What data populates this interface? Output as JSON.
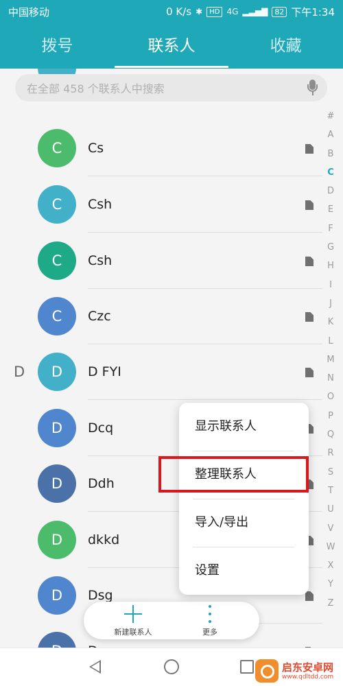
{
  "status_bar": {
    "carrier": "中国移动",
    "net_speed": "0 K/s",
    "hd_label": "HD",
    "network_label": "4G",
    "battery": "82",
    "time": "下午1:34"
  },
  "tabs": [
    {
      "label": "拨号",
      "active": false
    },
    {
      "label": "联系人",
      "active": true
    },
    {
      "label": "收藏",
      "active": false
    }
  ],
  "search": {
    "placeholder": "在全部 458 个联系人中搜索"
  },
  "contacts": [
    {
      "name": "",
      "initial": "",
      "color": "#43b0c9",
      "section": "",
      "sim_icon": false
    },
    {
      "name": "Cs",
      "initial": "C",
      "color": "#4cbc6c",
      "section": "",
      "sim_icon": true
    },
    {
      "name": "Csh",
      "initial": "C",
      "color": "#43b0c9",
      "section": "",
      "sim_icon": true
    },
    {
      "name": "Csh",
      "initial": "C",
      "color": "#1ea987",
      "section": "",
      "sim_icon": true
    },
    {
      "name": "Czc",
      "initial": "C",
      "color": "#4f86cd",
      "section": "",
      "sim_icon": true
    },
    {
      "name": "D FYI",
      "initial": "D",
      "color": "#43b0c9",
      "section": "D",
      "sim_icon": true
    },
    {
      "name": "Dcq",
      "initial": "D",
      "color": "#4f86cd",
      "section": "",
      "sim_icon": true
    },
    {
      "name": "Ddh",
      "initial": "D",
      "color": "#4a72a8",
      "section": "",
      "sim_icon": true
    },
    {
      "name": "dkkd",
      "initial": "D",
      "color": "#4cbc6c",
      "section": "",
      "sim_icon": true
    },
    {
      "name": "Dsg",
      "initial": "D",
      "color": "#4f86cd",
      "section": "",
      "sim_icon": true
    },
    {
      "name": "D",
      "initial": "D",
      "color": "#4a72a8",
      "section": "",
      "sim_icon": true
    }
  ],
  "alpha_index": [
    "#",
    "A",
    "B",
    "C",
    "D",
    "E",
    "F",
    "G",
    "H",
    "I",
    "J",
    "K",
    "L",
    "M",
    "N",
    "O",
    "P",
    "Q",
    "R",
    "S",
    "T",
    "U",
    "V",
    "W",
    "X",
    "Y",
    "Z"
  ],
  "alpha_index_active": "C",
  "menu": {
    "items": [
      "显示联系人",
      "整理联系人",
      "导入/导出",
      "设置"
    ],
    "highlighted": "整理联系人",
    "highlight_color": "#d8181e"
  },
  "bottom_actions": {
    "new_contact_label": "新建联系人",
    "more_label": "更多"
  },
  "watermark": {
    "title": "启东安卓网",
    "url": "www.qdltdd.com"
  },
  "colors": {
    "accent": "#1fa8b8"
  }
}
